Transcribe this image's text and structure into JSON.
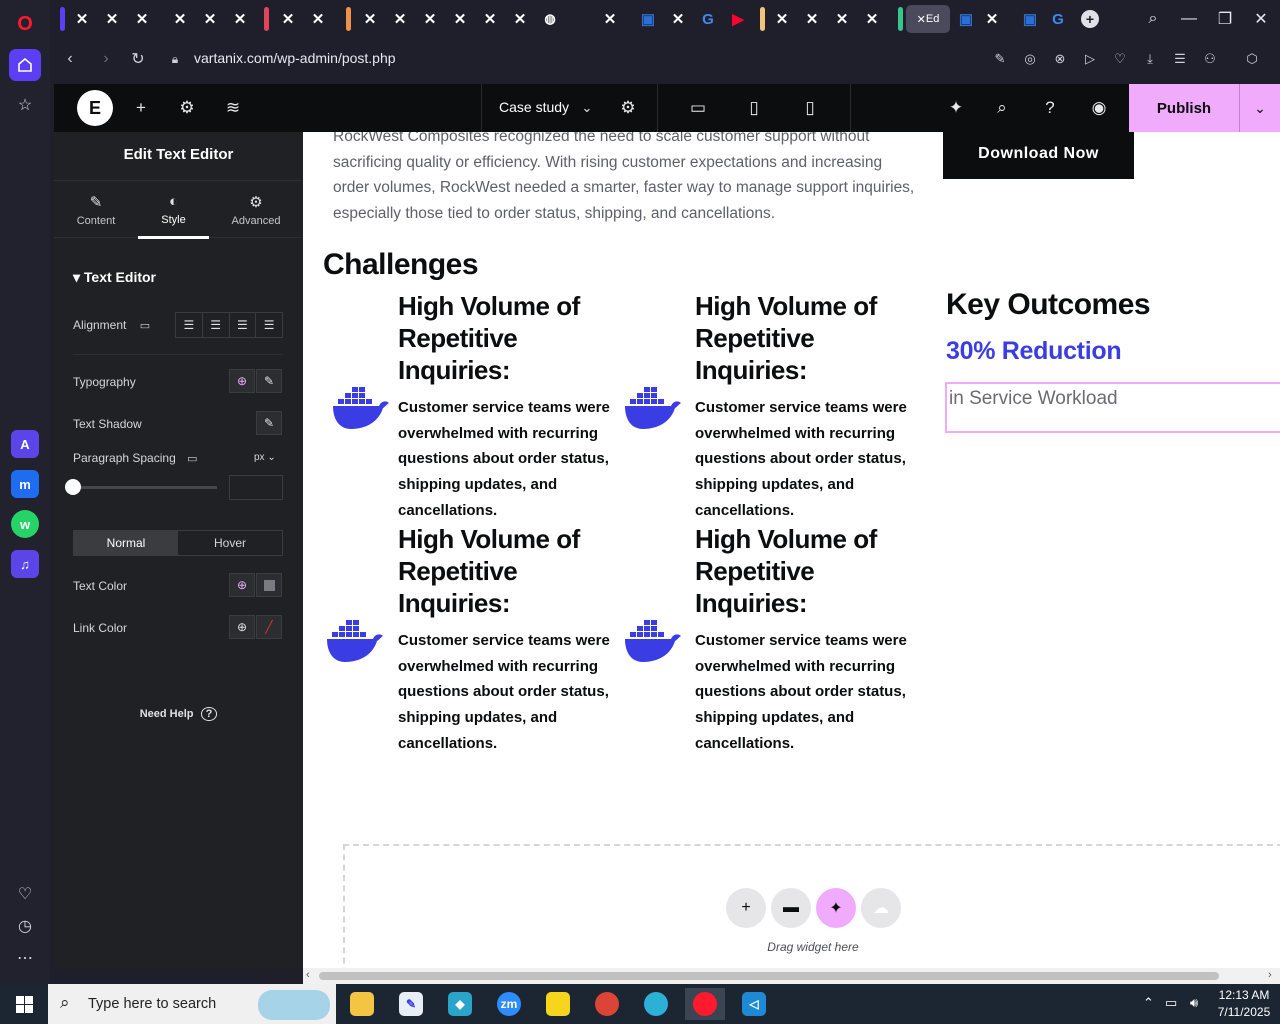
{
  "browser": {
    "url": "vartanix.com/wp-admin/post.php",
    "active_tab_label": "Ed"
  },
  "editor": {
    "document_title": "Case study",
    "publish_label": "Publish"
  },
  "panel": {
    "title": "Edit Text Editor",
    "tabs": [
      {
        "label": "Content"
      },
      {
        "label": "Style"
      },
      {
        "label": "Advanced"
      }
    ],
    "section": "Text Editor",
    "alignment_label": "Alignment",
    "typography_label": "Typography",
    "text_shadow_label": "Text Shadow",
    "paragraph_spacing_label": "Paragraph Spacing",
    "spacing_unit": "px",
    "state_normal": "Normal",
    "state_hover": "Hover",
    "text_color_label": "Text Color",
    "link_color_label": "Link Color",
    "need_help": "Need Help"
  },
  "page": {
    "intro": "RockWest Composites recognized the need to scale customer support without sacrificing quality or efficiency. With rising customer expectations and increasing order volumes, RockWest needed a smarter, faster way to manage support inquiries, especially those tied to order status, shipping, and cancellations.",
    "download_label": "Download Now",
    "challenges_title": "Challenges",
    "cards": [
      {
        "title": "High Volume of Repetitive Inquiries:",
        "text": "Customer service teams were overwhelmed with recurring questions about order status, shipping updates, and cancellations."
      },
      {
        "title": "High Volume of Repetitive Inquiries:",
        "text": "Customer service teams were overwhelmed with recurring questions about order status, shipping updates, and cancellations."
      },
      {
        "title": "High Volume of Repetitive Inquiries:",
        "text": "Customer service teams were overwhelmed with recurring questions about order status, shipping updates, and cancellations."
      },
      {
        "title": "High Volume of Repetitive Inquiries:",
        "text": "Customer service teams were overwhelmed with recurring questions about order status, shipping updates, and cancellations."
      }
    ],
    "outcomes_title": "Key Outcomes",
    "outcome_metric": "30% Reduction",
    "outcome_text": "in Service Workload",
    "drop_label": "Drag widget here"
  },
  "taskbar": {
    "search_placeholder": "Type here to search",
    "time": "12:13 AM",
    "date": "7/11/2025"
  },
  "colors": {
    "accent": "#f0abfc",
    "brand_blue": "#3b3de4",
    "panel_bg": "#1f2124",
    "topbar_bg": "#0c0d0e"
  }
}
